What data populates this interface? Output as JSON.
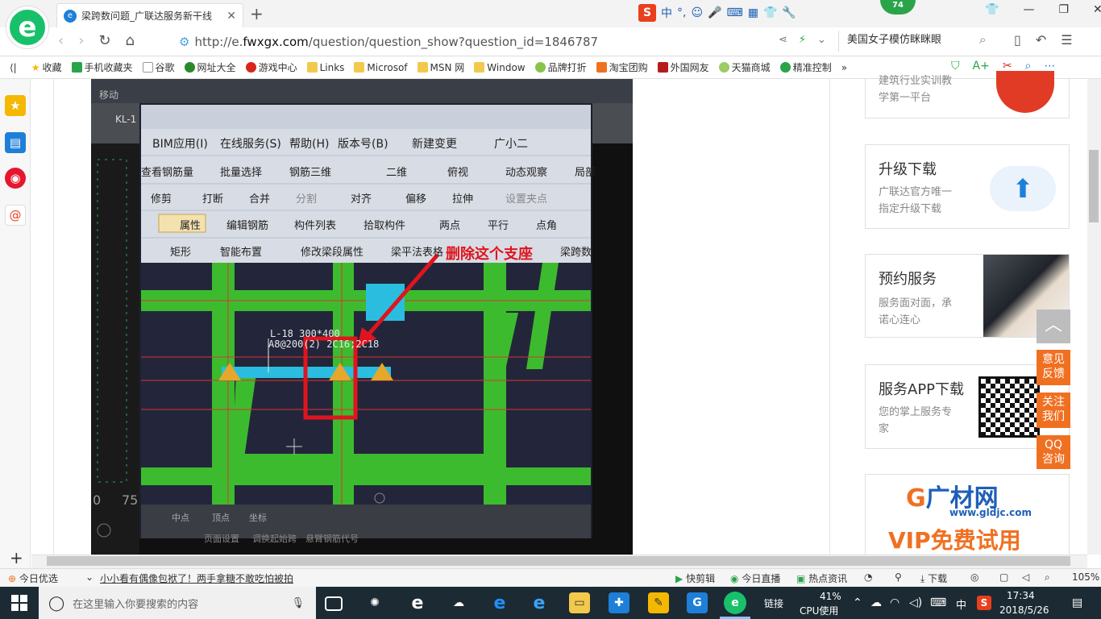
{
  "browser": {
    "tab_title": "梁跨数问题_广联达服务新干线",
    "badge_count": "74",
    "url_prefix": "http://e.",
    "url_domain": "fwxgx.com",
    "url_path": "/question/question_show?question_id=1846787",
    "search_text": "美国女子模仿眯眯眼"
  },
  "bookmarks": [
    "收藏",
    "手机收藏夹",
    "谷歌",
    "网址大全",
    "游戏中心",
    "Links",
    "Microsof",
    "MSN 网",
    "Window",
    "品牌打折",
    "淘宝团购",
    "外国网友",
    "天猫商城",
    "精准控制"
  ],
  "screenshot_content": {
    "menu_items": [
      "BIM应用(I)",
      "在线服务(S)",
      "帮助(H)",
      "版本号(B)",
      "新建变更",
      "广小二"
    ],
    "toolbar1": [
      "查看钢筋量",
      "批量选择",
      "钢筋三维",
      "二维",
      "俯视",
      "动态观察",
      "局部"
    ],
    "toolbar2": [
      "修剪",
      "打断",
      "合并",
      "分割",
      "对齐",
      "偏移",
      "拉伸",
      "设置夹点"
    ],
    "toolbar3": [
      "属性",
      "编辑钢筋",
      "构件列表",
      "拾取构件",
      "两点",
      "平行",
      "点角"
    ],
    "toolbar4": [
      "矩形",
      "智能布置",
      "修改梁段属性",
      "梁平法表格",
      "梁跨数"
    ],
    "top_left_labels": [
      "移动",
      "KL-1"
    ],
    "annotation": "删除这个支座",
    "beam_label_1": "L-18 300*400",
    "beam_label_2": "A8@200(2) 2C16;2C18",
    "bottom_labels": [
      "中点",
      "顶点",
      "坐标"
    ],
    "bottom_labels_2": [
      "页面设置",
      "调换起始跨",
      "悬臂钢筋代号"
    ],
    "ruler_label": "75"
  },
  "sidebar": {
    "card0": {
      "desc1": "建筑行业实训教",
      "desc2": "学第一平台"
    },
    "card1": {
      "title": "升级下载",
      "desc1": "广联达官方唯一",
      "desc2": "指定升级下载"
    },
    "card2": {
      "title": "预约服务",
      "desc1": "服务面对面，承",
      "desc2": "诺心连心"
    },
    "card3": {
      "title": "服务APP下载",
      "desc1": "您的掌上服务专",
      "desc2": "家"
    },
    "card4": {
      "brand": "广材网",
      "site": "www.gldjc.com",
      "promo": "VIP免费试用"
    },
    "float_buttons": [
      "意见反馈",
      "关注我们",
      "QQ咨询"
    ]
  },
  "statusbar": {
    "today": "今日优选",
    "news": "小小看有偶像包袱了！两手拿糖不敢吃怕被拍",
    "quick_clip": "快剪辑",
    "live": "今日直播",
    "hot_news": "热点资讯",
    "download": "下载",
    "zoom": "105%"
  },
  "taskbar": {
    "search_placeholder": "在这里输入你要搜索的内容",
    "links": "链接",
    "cpu_pct": "41%",
    "cpu_label": "CPU使用",
    "ime": "中",
    "time": "17:34",
    "date": "2018/5/26"
  }
}
